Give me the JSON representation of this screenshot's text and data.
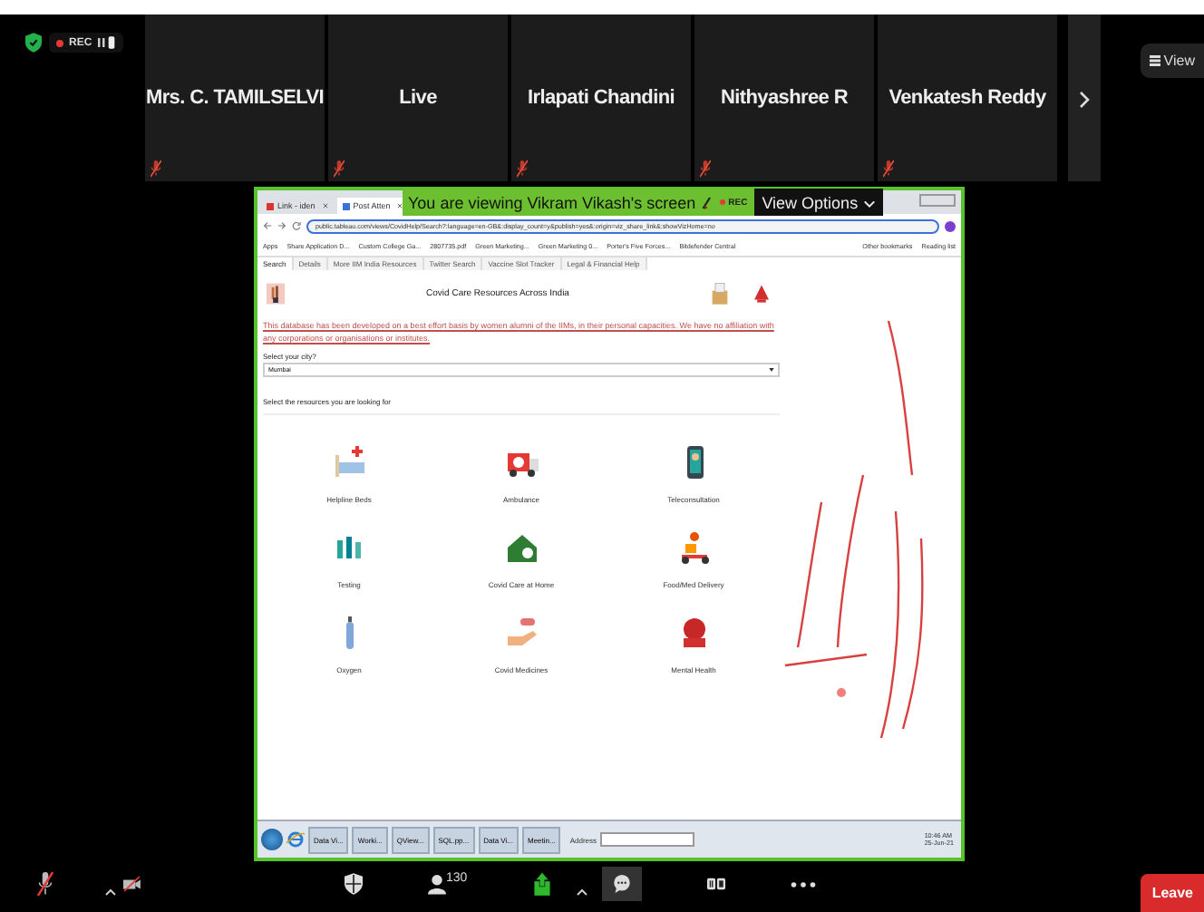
{
  "meeting_status": {
    "rec_label": "REC"
  },
  "participants": [
    {
      "name": "Mrs. C. TAMILSELVI",
      "muted": true
    },
    {
      "name": "Live",
      "muted": true
    },
    {
      "name": "Irlapati Chandini",
      "muted": true
    },
    {
      "name": "Nithyashree R",
      "muted": true
    },
    {
      "name": "Venkatesh Reddy",
      "muted": true
    }
  ],
  "view_button": {
    "label": "View"
  },
  "share_banner": {
    "text": "You are viewing Vikram Vikash's screen",
    "rec_label": "REC",
    "options_label": "View Options"
  },
  "browser": {
    "tabs": [
      {
        "label": "Link - iden",
        "selected": false
      },
      {
        "label": "Post Atten",
        "selected": true
      }
    ],
    "url": "public.tableau.com/views/CovidHelp/Search?:language=en-GB&:display_count=y&publish=yes&:origin=viz_share_link&:showVizHome=no",
    "bookmarks": [
      "Apps",
      "Share Application D...",
      "Custom College Ga...",
      "2807735.pdf",
      "Green Marketing...",
      "Green Marketing 0...",
      "Porter's Five Forces...",
      "Bitdefender Central"
    ],
    "other_bookmarks": "Other bookmarks",
    "reading_list": "Reading list"
  },
  "page": {
    "tabs": [
      {
        "label": "Search",
        "selected": true
      },
      {
        "label": "Details",
        "selected": false
      },
      {
        "label": "More IIM India Resources",
        "selected": false
      },
      {
        "label": "Twitter Search",
        "selected": false
      },
      {
        "label": "Vaccine Slot Tracker",
        "selected": false
      },
      {
        "label": "Legal & Financial Help",
        "selected": false
      }
    ],
    "title": "Covid Care Resources Across India",
    "disclaimer": "This database has been developed on a best effort basis by women alumni of the IIMs, in their personal capacities. We have no affiliation with any corporations or organisations or institutes.",
    "city_label": "Select your city?",
    "city_value": "Mumbai",
    "resources_label": "Select the resources you are looking for",
    "resources": [
      "Helpline Beds",
      "Ambulance",
      "Teleconsultation",
      "Testing",
      "Covid Care at Home",
      "Food/Med Delivery",
      "Oxygen",
      "Covid Medicines",
      "Mental Health"
    ]
  },
  "taskbar": {
    "items": [
      "Data Vi...",
      "Worki...",
      "QView...",
      "SQL.pp...",
      "Data Vi...",
      "Meetin..."
    ],
    "address_label": "Address",
    "time": "10:46 AM",
    "date": "25-Jun-21"
  },
  "toolbar": {
    "participant_count": "130",
    "leave_label": "Leave",
    "audio_muted": true,
    "video_off": true
  }
}
